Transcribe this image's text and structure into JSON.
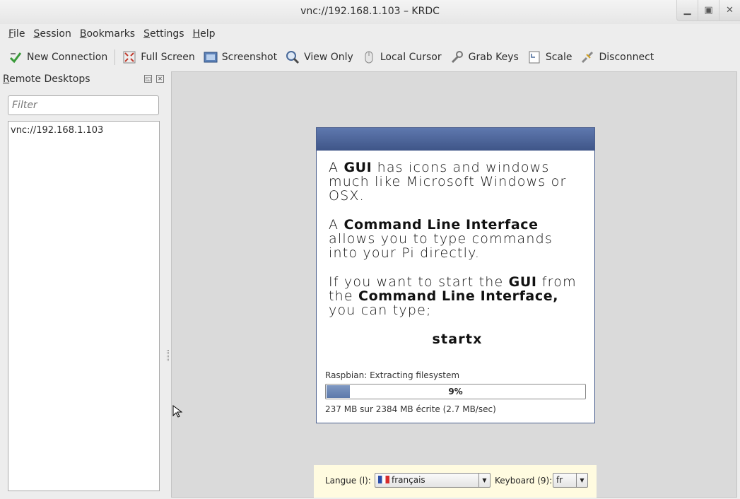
{
  "window": {
    "title": "vnc://192.168.1.103 – KRDC",
    "minimize_icon": "minimize-icon",
    "maximize_icon": "maximize-icon",
    "close_icon": "close-icon"
  },
  "menubar": [
    {
      "accel": "F",
      "rest": "ile"
    },
    {
      "accel": "S",
      "rest": "ession"
    },
    {
      "accel": "B",
      "rest": "ookmarks"
    },
    {
      "accel": "S",
      "rest": "ettings"
    },
    {
      "accel": "H",
      "rest": "elp"
    }
  ],
  "toolbar": {
    "new_connection": "New Connection",
    "full_screen": "Full Screen",
    "screenshot": "Screenshot",
    "view_only": "View Only",
    "local_cursor": "Local Cursor",
    "grab_keys": "Grab Keys",
    "scale": "Scale",
    "disconnect": "Disconnect"
  },
  "sidebar": {
    "title_accel": "R",
    "title_rest": "emote Desktops",
    "filter_placeholder": "Filter",
    "items": [
      "vnc://192.168.1.103"
    ]
  },
  "remote": {
    "slide": {
      "p1_a": "A ",
      "p1_b": "GUI",
      "p1_c": " has icons and windows much like Microsoft Windows or OSX.",
      "p2_a": "A ",
      "p2_b": "Command Line Interface",
      "p2_c": " allows you to type commands into your Pi directly.",
      "p3_a": "If you want to start the ",
      "p3_b": "GUI",
      "p3_c": " from the ",
      "p3_d": "Command Line Interface,",
      "p3_e": " you can type;",
      "command": "startx"
    },
    "status": "Raspbian: Extracting filesystem",
    "progress_percent": 9,
    "progress_label": "9%",
    "rate": "237 MB sur 2384 MB écrite (2.7 MB/sec)",
    "langue_label": "Langue (l):",
    "langue_value": "français",
    "keyboard_label": "Keyboard (9):",
    "keyboard_value": "fr"
  }
}
